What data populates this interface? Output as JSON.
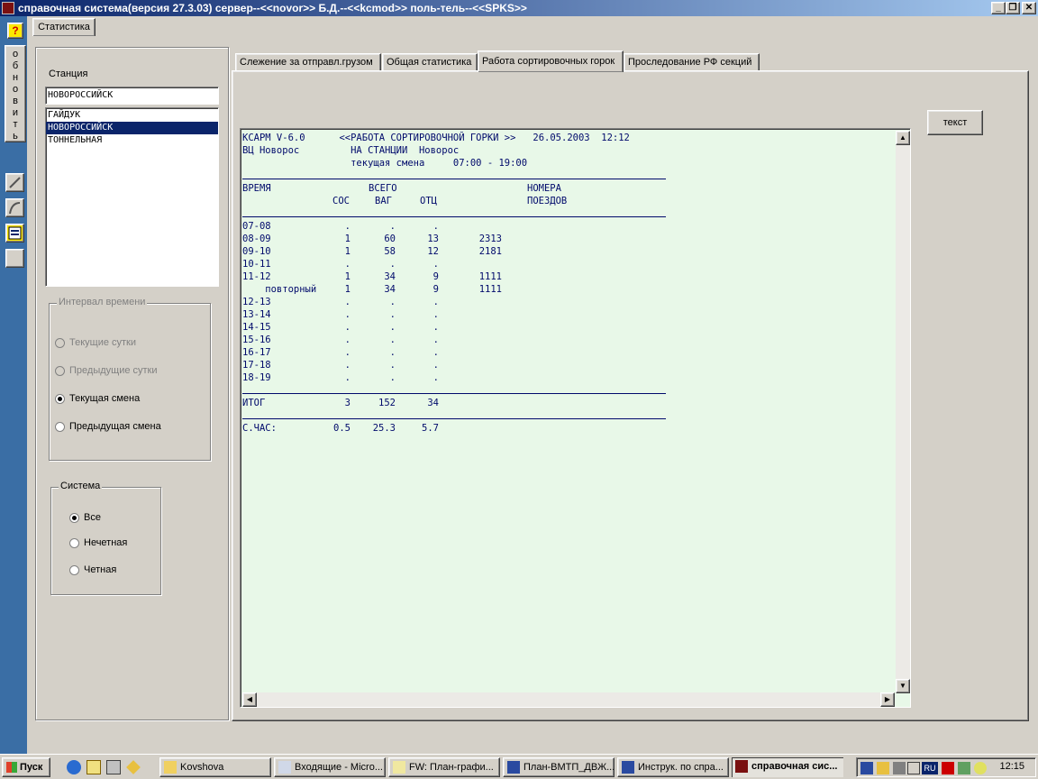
{
  "window": {
    "title": "справочная система(версия 27.3.03) сервер--<<novor>> Б.Д.--<<kcmod>> поль-тель--<<SPKS>>",
    "min": "_",
    "max": "❐",
    "close": "✕"
  },
  "toolbar": {
    "help": "?",
    "refresh_letters": [
      "о",
      "б",
      "н",
      "о",
      "в",
      "и",
      "т",
      "ь"
    ]
  },
  "main_tab": "Статистика",
  "station": {
    "label": "Станция",
    "value": "НОВОРОССИЙСК",
    "list": [
      "ГАЙДУК",
      "НОВОРОССИЙСК",
      "ТОННЕЛЬНАЯ"
    ],
    "selected_index": 1
  },
  "interval": {
    "legend": "Интервал времени",
    "options": [
      "Текущие сутки",
      "Предыдущие сутки",
      "Текущая смена",
      "Предыдущая смена"
    ],
    "selected_index": 2
  },
  "system": {
    "legend": "Система",
    "options": [
      "Все",
      "Нечетная",
      "Четная"
    ],
    "selected_index": 0
  },
  "tabs": [
    "Слежение за отправл.грузом",
    "Общая статистика",
    "Работа сортировочных горок",
    "Проследование РФ секций"
  ],
  "active_tab": 2,
  "text_button": "текст",
  "report": {
    "header": [
      "КСАРМ V-6.0      <<РАБОТА СОРТИРОВОЧНОЙ ГОРКИ >>   26.05.2003  12:12",
      "ВЦ Новорос         НА СТАНЦИИ  Новорос",
      "                   текущая смена     07:00 - 19:00"
    ],
    "col_headers": {
      "time": "ВРЕМЯ",
      "total": "ВСЕГО",
      "numbers": "НОМЕРА",
      "sos": "СОС",
      "vag": "ВАГ",
      "otc": "ОТЦ",
      "trains": "ПОЕЗДОВ"
    },
    "rows": [
      {
        "time": "07-08",
        "sos": ".",
        "vag": ".",
        "otc": ".",
        "train": ""
      },
      {
        "time": "08-09",
        "sos": "1",
        "vag": "60",
        "otc": "13",
        "train": "2313"
      },
      {
        "time": "09-10",
        "sos": "1",
        "vag": "58",
        "otc": "12",
        "train": "2181"
      },
      {
        "time": "10-11",
        "sos": ".",
        "vag": ".",
        "otc": ".",
        "train": ""
      },
      {
        "time": "11-12",
        "sos": "1",
        "vag": "34",
        "otc": "9",
        "train": "1111"
      },
      {
        "time": "    повторный",
        "sos": "1",
        "vag": "34",
        "otc": "9",
        "train": "1111"
      },
      {
        "time": "12-13",
        "sos": ".",
        "vag": ".",
        "otc": ".",
        "train": ""
      },
      {
        "time": "13-14",
        "sos": ".",
        "vag": ".",
        "otc": ".",
        "train": ""
      },
      {
        "time": "14-15",
        "sos": ".",
        "vag": ".",
        "otc": ".",
        "train": ""
      },
      {
        "time": "15-16",
        "sos": ".",
        "vag": ".",
        "otc": ".",
        "train": ""
      },
      {
        "time": "16-17",
        "sos": ".",
        "vag": ".",
        "otc": ".",
        "train": ""
      },
      {
        "time": "17-18",
        "sos": ".",
        "vag": ".",
        "otc": ".",
        "train": ""
      },
      {
        "time": "18-19",
        "sos": ".",
        "vag": ".",
        "otc": ".",
        "train": ""
      }
    ],
    "total": {
      "label": "ИТОГ",
      "sos": "3",
      "vag": "152",
      "otc": "34"
    },
    "avg": {
      "label": "С.ЧАС:",
      "sos": "0.5",
      "vag": "25.3",
      "otc": "5.7"
    }
  },
  "taskbar": {
    "start": "Пуск",
    "tasks": [
      "Kovshova",
      "Входящие - Micro...",
      "FW: План-графи...",
      "План-ВМТП_ДВЖ...",
      "Инструк. по спра...",
      "справочная сис..."
    ],
    "active_task": 5,
    "lang": "RU",
    "clock": "12:15"
  },
  "colors": {
    "titlebar_start": "#0a246a",
    "titlebar_end": "#a6caf0",
    "report_bg": "#e8f8e8",
    "report_text": "#000a6b",
    "selection": "#0a246a",
    "toolbar_bg": "#3a6ea5"
  }
}
